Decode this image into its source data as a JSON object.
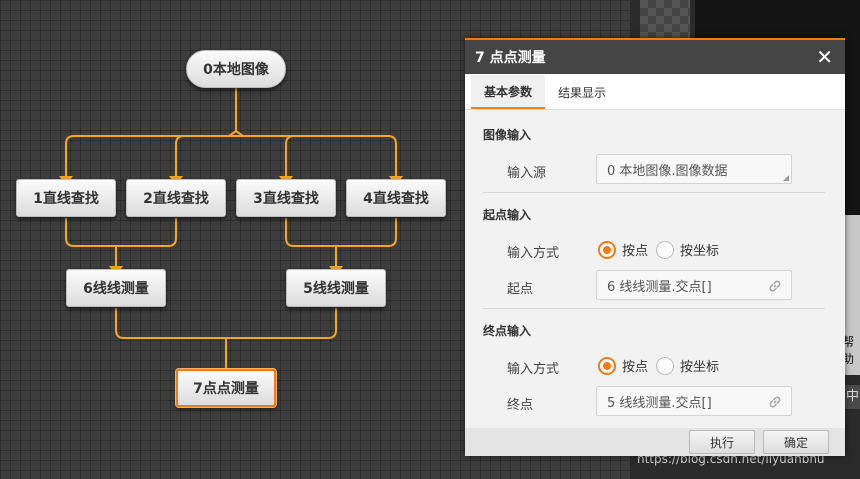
{
  "flow": {
    "nodes": {
      "n0": "0本地图像",
      "n1": "1直线查找",
      "n2": "2直线查找",
      "n3": "3直线查找",
      "n4": "4直线查找",
      "n6": "6线线测量",
      "n5": "5线线测量",
      "n7": "7点点测量"
    },
    "selected": "n7",
    "wire_color": "#f5a623"
  },
  "dialog": {
    "title": "7 点点测量",
    "close_icon": "close-icon",
    "tabs": [
      "基本参数",
      "结果显示"
    ],
    "active_tab": "基本参数",
    "image_input": {
      "title": "图像输入",
      "source_label": "输入源",
      "source_value": "0 本地图像.图像数据"
    },
    "start_input": {
      "title": "起点输入",
      "mode_label": "输入方式",
      "option_point": "按点",
      "option_coord": "按坐标",
      "selected": "按点",
      "point_label": "起点",
      "point_value": "6 线线测量.交点[]"
    },
    "end_input": {
      "title": "终点输入",
      "mode_label": "输入方式",
      "option_point": "按点",
      "option_coord": "按坐标",
      "selected": "按点",
      "point_label": "终点",
      "point_value": "5 线线测量.交点[]"
    },
    "buttons": {
      "execute": "执行",
      "confirm": "确定"
    },
    "accent": "#f07b18"
  },
  "side": {
    "help_label": "帮助",
    "zh_label": "中",
    "watermark": "https://blog.csdn.net/liyuanbhu"
  }
}
